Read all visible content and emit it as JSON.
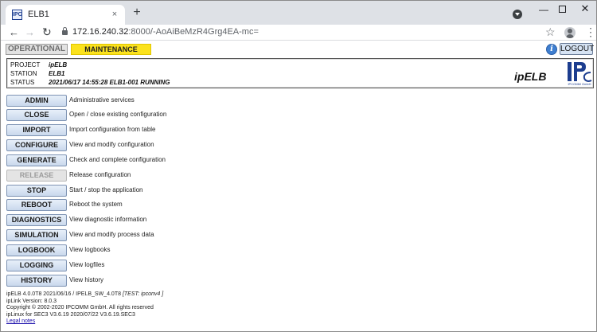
{
  "browser": {
    "tab_title": "ELB1",
    "tab_favicon": "IPC",
    "tab_close": "×",
    "new_tab": "+",
    "url_host": "172.16.240.32",
    "url_path": ":8000/-AoAiBeMzR4Grg4EA-mc=",
    "icons": [
      "favicon-icon",
      "close-icon",
      "plus-icon",
      "tab-search-icon",
      "minimize-icon",
      "maximize-icon",
      "close-window-icon",
      "back-arrow-icon",
      "forward-arrow-icon",
      "reload-icon",
      "lock-icon",
      "star-icon",
      "avatar-icon",
      "kebab-menu-icon"
    ]
  },
  "header": {
    "mode_operational": "OPERATIONAL",
    "mode_maintenance": "MAINTENANCE",
    "logout": "LOGOUT",
    "info_icon": "i",
    "maintenance_color": "#fbe21d"
  },
  "info": {
    "project_label": "PROJECT",
    "project_value": "ipELB",
    "station_label": "STATION",
    "station_value": "ELB1",
    "status_label": "STATUS",
    "status_value": "2021/06/17 14:55:28 ELB1-001 RUNNING",
    "brand": "ipELB",
    "logo_caption": "IPCOMM GmbH"
  },
  "menu": [
    {
      "label": "ADMIN",
      "desc": "Administrative services",
      "enabled": true
    },
    {
      "label": "CLOSE",
      "desc": "Open / close existing configuration",
      "enabled": true
    },
    {
      "label": "IMPORT",
      "desc": "Import configuration from table",
      "enabled": true
    },
    {
      "label": "CONFIGURE",
      "desc": "View and modify configuration",
      "enabled": true
    },
    {
      "label": "GENERATE",
      "desc": "Check and complete configuration",
      "enabled": true
    },
    {
      "label": "RELEASE",
      "desc": "Release configuration",
      "enabled": false
    },
    {
      "label": "STOP",
      "desc": "Start / stop the application",
      "enabled": true
    },
    {
      "label": "REBOOT",
      "desc": "Reboot the system",
      "enabled": true
    },
    {
      "label": "DIAGNOSTICS",
      "desc": "View diagnostic information",
      "enabled": true
    },
    {
      "label": "SIMULATION",
      "desc": "View and modify process data",
      "enabled": true
    },
    {
      "label": "LOGBOOK",
      "desc": "View logbooks",
      "enabled": true
    },
    {
      "label": "LOGGING",
      "desc": "View logfiles",
      "enabled": true
    },
    {
      "label": "HISTORY",
      "desc": "View history",
      "enabled": true
    }
  ],
  "footer": {
    "version_line": "ipELB 4.0.0T8 2021/06/16 / IPELB_SW_4.0T8",
    "test_tag": "[TEST: ipconv4 ]",
    "iplink_line": "ipLink Version: 8.0.3",
    "copyright_line": "Copyright © 2002-2020 IPCOMM GmbH. All rights reserved",
    "iplinux_line": "ipLinux for SEC3 V3.6.19 2020/07/22 V3.6.19.SEC3",
    "legal_link": "Legal notes"
  }
}
